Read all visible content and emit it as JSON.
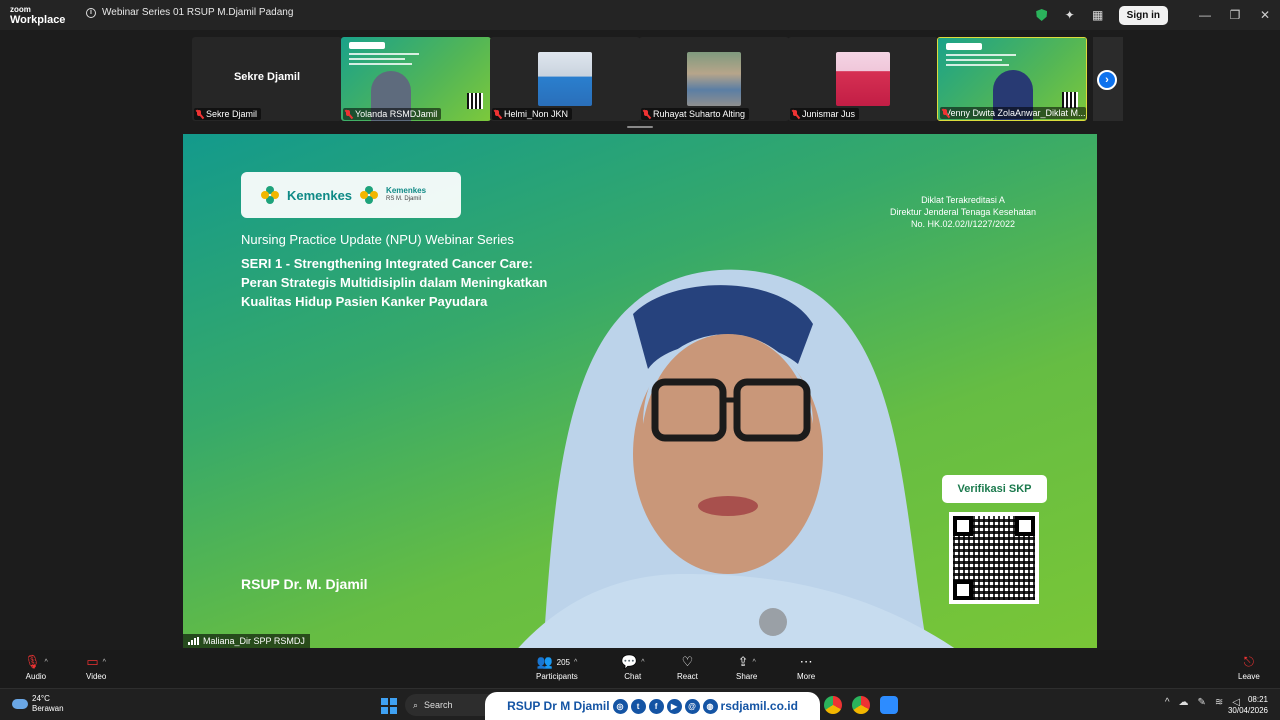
{
  "app": {
    "logo_small": "zoom",
    "logo_big": "Workplace",
    "meeting_title": "Webinar Series 01 RSUP M.Djamil Padang",
    "sign_in": "Sign in"
  },
  "gallery": {
    "big_name": "Sekre Djamil",
    "participants": [
      {
        "name": "Sekre Djamil"
      },
      {
        "name": "Yolanda RSMDJamil"
      },
      {
        "name": "Helmi_Non JKN"
      },
      {
        "name": "Ruhayat Suharto Alting"
      },
      {
        "name": "Junismar Jus"
      },
      {
        "name": "Venny Dwita ZolaAnwar_Diklat M..."
      }
    ]
  },
  "slide": {
    "kemenkes": "Kemenkes",
    "kemenkes2": "Kemenkes",
    "kemenkes2_sub": "RS M. Djamil",
    "series": "Nursing Practice Update (NPU) Webinar Series",
    "seri_line1": "SERI 1 - Strengthening Integrated Cancer Care:",
    "seri_line2": "Peran Strategis  Multidisiplin dalam Meningkatkan",
    "seri_line3": "Kualitas Hidup Pasien Kanker Payudara",
    "accred1": "Diklat Terakreditasi A",
    "accred2": "Direktur Jenderal Tenaga Kesehatan",
    "accred3": "No. HK.02.02/I/1227/2022",
    "verif": "Verifikasi SKP",
    "rsup": "RSUP Dr. M. Djamil",
    "speaker": "Maliana_Dir SPP RSMDJ"
  },
  "toolbar": {
    "audio": "Audio",
    "video": "Video",
    "participants": "Participants",
    "participants_count": "205",
    "chat": "Chat",
    "react": "React",
    "share": "Share",
    "more": "More",
    "leave": "Leave"
  },
  "taskbar": {
    "temp": "24°C",
    "weather": "Berawan",
    "search": "Search",
    "banner_name": "RSUP Dr M Djamil",
    "banner_url": "rsdjamil.co.id",
    "time": "08:21",
    "date": "30/04/2026"
  },
  "colors": {
    "accent_blue": "#0e72ed",
    "mute_red": "#e33333",
    "slide_green": "#66bd43",
    "slide_teal": "#139a8c"
  }
}
